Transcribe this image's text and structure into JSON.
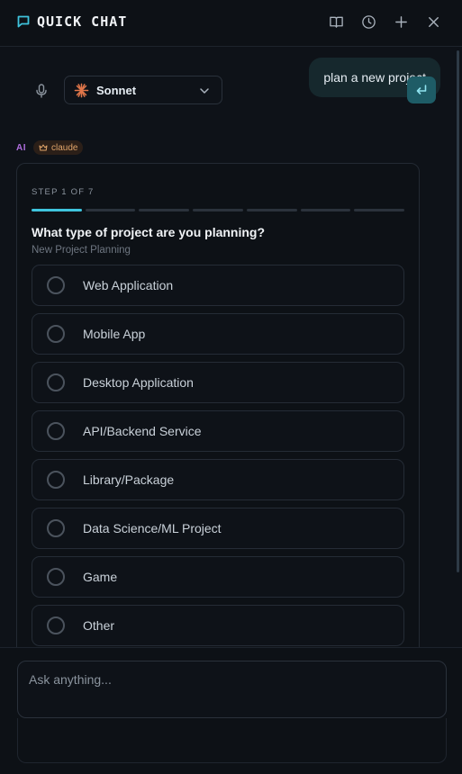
{
  "header": {
    "title": "QUICK CHAT",
    "icons": [
      "chat-icon",
      "book-icon",
      "history-icon",
      "plus-icon",
      "close-icon"
    ]
  },
  "chat": {
    "user_message": "plan a new project",
    "ai_label": "AI",
    "model_badge": "claude",
    "card": {
      "step_label": "STEP 1 OF 7",
      "progress": {
        "current": 1,
        "total": 7
      },
      "question": "What type of project are you planning?",
      "subtitle": "New Project Planning",
      "options": [
        {
          "label": "Web Application"
        },
        {
          "label": "Mobile App"
        },
        {
          "label": "Desktop Application"
        },
        {
          "label": "API/Backend Service"
        },
        {
          "label": "Library/Package"
        },
        {
          "label": "Data Science/ML Project"
        },
        {
          "label": "Game"
        },
        {
          "label": "Other"
        }
      ]
    }
  },
  "composer": {
    "placeholder": "Ask anything...",
    "model": "Sonnet"
  },
  "colors": {
    "accent": "#3fc4dd",
    "ai_label": "#b06ee0",
    "badge_text": "#e0a46a",
    "send_button": "#1e5c66",
    "spark": "#e0764a"
  }
}
